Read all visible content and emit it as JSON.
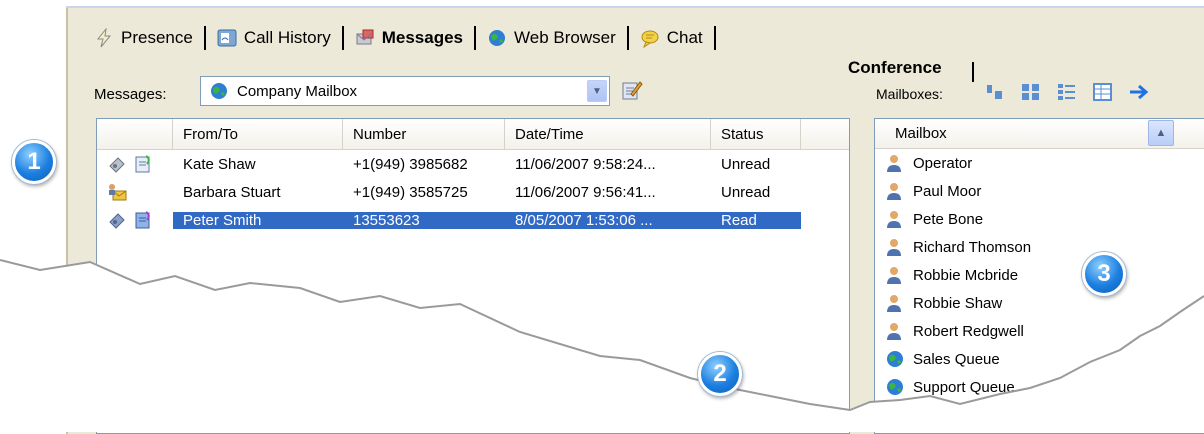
{
  "tabs": [
    {
      "label": "Presence",
      "icon": "lightning-icon"
    },
    {
      "label": "Call History",
      "icon": "call-history-icon"
    },
    {
      "label": "Messages",
      "icon": "messages-icon"
    },
    {
      "label": "Web Browser",
      "icon": "globe-icon"
    },
    {
      "label": "Chat",
      "icon": "chat-bubble-icon"
    }
  ],
  "active_tab": "Messages",
  "conference_tab": {
    "label": "Conference"
  },
  "messages": {
    "label": "Messages:",
    "selected_mailbox": "Company Mailbox",
    "columns": [
      "From/To",
      "Number",
      "Date/Time",
      "Status"
    ],
    "rows": [
      {
        "from": "Kate Shaw",
        "number": "+1(949) 3985682",
        "datetime": "11/06/2007 9:58:24...",
        "status": "Unread"
      },
      {
        "from": "Barbara Stuart",
        "number": "+1(949) 3585725",
        "datetime": "11/06/2007 9:56:41...",
        "status": "Unread"
      },
      {
        "from": "Peter Smith",
        "number": "13553623",
        "datetime": "8/05/2007 1:53:06 ...",
        "status": "Read"
      }
    ]
  },
  "mailboxes": {
    "label": "Mailboxes:",
    "column": "Mailbox",
    "items": [
      {
        "name": "Operator",
        "icon": "person-icon"
      },
      {
        "name": "Paul Moor",
        "icon": "person-icon"
      },
      {
        "name": "Pete Bone",
        "icon": "person-icon"
      },
      {
        "name": "Richard Thomson",
        "icon": "person-icon"
      },
      {
        "name": "Robbie Mcbride",
        "icon": "person-icon"
      },
      {
        "name": "Robbie Shaw",
        "icon": "person-icon"
      },
      {
        "name": "Robert Redgwell",
        "icon": "person-icon"
      },
      {
        "name": "Sales Queue",
        "icon": "globe-icon"
      },
      {
        "name": "Support Queue",
        "icon": "globe-icon"
      }
    ]
  },
  "callouts": [
    "1",
    "2",
    "3"
  ],
  "colors": {
    "selection": "#316ac5",
    "window": "#ece9d8",
    "badge": "#1c7fe0"
  }
}
